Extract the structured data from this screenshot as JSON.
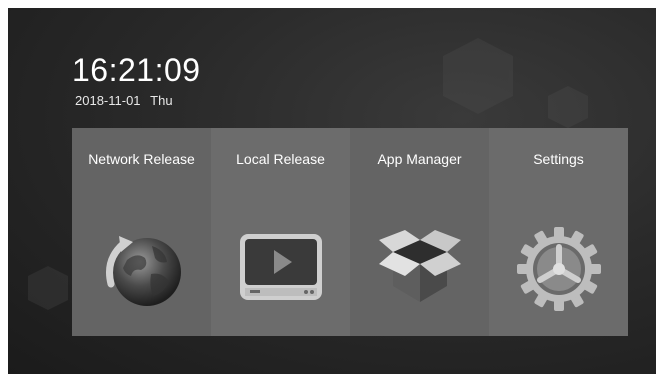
{
  "status": {
    "time": "16:21:09",
    "date": "2018-11-01",
    "weekday": "Thu"
  },
  "tiles": [
    {
      "label": "Network Release",
      "icon": "globe-refresh-icon"
    },
    {
      "label": "Local Release",
      "icon": "tv-play-icon"
    },
    {
      "label": "App Manager",
      "icon": "open-box-icon"
    },
    {
      "label": "Settings",
      "icon": "gear-icon"
    }
  ],
  "colors": {
    "background": "#222222",
    "tile": "#666666",
    "text": "#ffffff"
  }
}
